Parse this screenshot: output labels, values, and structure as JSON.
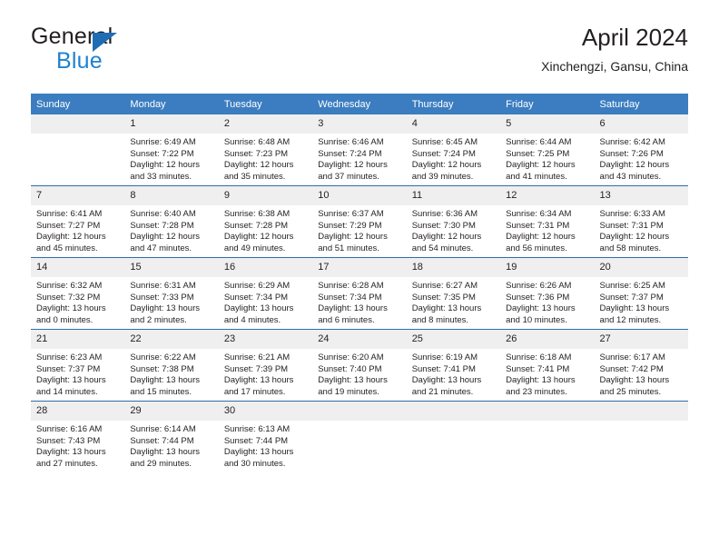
{
  "brand": {
    "name_top": "General",
    "name_bottom": "Blue",
    "accent_color": "#1f81d0",
    "triangle_color": "#1f6cb4"
  },
  "header": {
    "title": "April 2024",
    "subtitle": "Xinchengzi, Gansu, China"
  },
  "theme": {
    "header_bg": "#3b7dc0",
    "daynum_bg": "#efefef",
    "row_line": "#2e6da4",
    "text": "#231f20"
  },
  "weekdays": [
    "Sunday",
    "Monday",
    "Tuesday",
    "Wednesday",
    "Thursday",
    "Friday",
    "Saturday"
  ],
  "labels": {
    "sunrise_prefix": "Sunrise:",
    "sunset_prefix": "Sunset:",
    "daylight_prefix": "Daylight:"
  },
  "weeks": [
    [
      {
        "day": "",
        "empty": true
      },
      {
        "day": "1",
        "sunrise": "Sunrise: 6:49 AM",
        "sunset": "Sunset: 7:22 PM",
        "daylight_l1": "Daylight: 12 hours",
        "daylight_l2": "and 33 minutes."
      },
      {
        "day": "2",
        "sunrise": "Sunrise: 6:48 AM",
        "sunset": "Sunset: 7:23 PM",
        "daylight_l1": "Daylight: 12 hours",
        "daylight_l2": "and 35 minutes."
      },
      {
        "day": "3",
        "sunrise": "Sunrise: 6:46 AM",
        "sunset": "Sunset: 7:24 PM",
        "daylight_l1": "Daylight: 12 hours",
        "daylight_l2": "and 37 minutes."
      },
      {
        "day": "4",
        "sunrise": "Sunrise: 6:45 AM",
        "sunset": "Sunset: 7:24 PM",
        "daylight_l1": "Daylight: 12 hours",
        "daylight_l2": "and 39 minutes."
      },
      {
        "day": "5",
        "sunrise": "Sunrise: 6:44 AM",
        "sunset": "Sunset: 7:25 PM",
        "daylight_l1": "Daylight: 12 hours",
        "daylight_l2": "and 41 minutes."
      },
      {
        "day": "6",
        "sunrise": "Sunrise: 6:42 AM",
        "sunset": "Sunset: 7:26 PM",
        "daylight_l1": "Daylight: 12 hours",
        "daylight_l2": "and 43 minutes."
      }
    ],
    [
      {
        "day": "7",
        "sunrise": "Sunrise: 6:41 AM",
        "sunset": "Sunset: 7:27 PM",
        "daylight_l1": "Daylight: 12 hours",
        "daylight_l2": "and 45 minutes."
      },
      {
        "day": "8",
        "sunrise": "Sunrise: 6:40 AM",
        "sunset": "Sunset: 7:28 PM",
        "daylight_l1": "Daylight: 12 hours",
        "daylight_l2": "and 47 minutes."
      },
      {
        "day": "9",
        "sunrise": "Sunrise: 6:38 AM",
        "sunset": "Sunset: 7:28 PM",
        "daylight_l1": "Daylight: 12 hours",
        "daylight_l2": "and 49 minutes."
      },
      {
        "day": "10",
        "sunrise": "Sunrise: 6:37 AM",
        "sunset": "Sunset: 7:29 PM",
        "daylight_l1": "Daylight: 12 hours",
        "daylight_l2": "and 51 minutes."
      },
      {
        "day": "11",
        "sunrise": "Sunrise: 6:36 AM",
        "sunset": "Sunset: 7:30 PM",
        "daylight_l1": "Daylight: 12 hours",
        "daylight_l2": "and 54 minutes."
      },
      {
        "day": "12",
        "sunrise": "Sunrise: 6:34 AM",
        "sunset": "Sunset: 7:31 PM",
        "daylight_l1": "Daylight: 12 hours",
        "daylight_l2": "and 56 minutes."
      },
      {
        "day": "13",
        "sunrise": "Sunrise: 6:33 AM",
        "sunset": "Sunset: 7:31 PM",
        "daylight_l1": "Daylight: 12 hours",
        "daylight_l2": "and 58 minutes."
      }
    ],
    [
      {
        "day": "14",
        "sunrise": "Sunrise: 6:32 AM",
        "sunset": "Sunset: 7:32 PM",
        "daylight_l1": "Daylight: 13 hours",
        "daylight_l2": "and 0 minutes."
      },
      {
        "day": "15",
        "sunrise": "Sunrise: 6:31 AM",
        "sunset": "Sunset: 7:33 PM",
        "daylight_l1": "Daylight: 13 hours",
        "daylight_l2": "and 2 minutes."
      },
      {
        "day": "16",
        "sunrise": "Sunrise: 6:29 AM",
        "sunset": "Sunset: 7:34 PM",
        "daylight_l1": "Daylight: 13 hours",
        "daylight_l2": "and 4 minutes."
      },
      {
        "day": "17",
        "sunrise": "Sunrise: 6:28 AM",
        "sunset": "Sunset: 7:34 PM",
        "daylight_l1": "Daylight: 13 hours",
        "daylight_l2": "and 6 minutes."
      },
      {
        "day": "18",
        "sunrise": "Sunrise: 6:27 AM",
        "sunset": "Sunset: 7:35 PM",
        "daylight_l1": "Daylight: 13 hours",
        "daylight_l2": "and 8 minutes."
      },
      {
        "day": "19",
        "sunrise": "Sunrise: 6:26 AM",
        "sunset": "Sunset: 7:36 PM",
        "daylight_l1": "Daylight: 13 hours",
        "daylight_l2": "and 10 minutes."
      },
      {
        "day": "20",
        "sunrise": "Sunrise: 6:25 AM",
        "sunset": "Sunset: 7:37 PM",
        "daylight_l1": "Daylight: 13 hours",
        "daylight_l2": "and 12 minutes."
      }
    ],
    [
      {
        "day": "21",
        "sunrise": "Sunrise: 6:23 AM",
        "sunset": "Sunset: 7:37 PM",
        "daylight_l1": "Daylight: 13 hours",
        "daylight_l2": "and 14 minutes."
      },
      {
        "day": "22",
        "sunrise": "Sunrise: 6:22 AM",
        "sunset": "Sunset: 7:38 PM",
        "daylight_l1": "Daylight: 13 hours",
        "daylight_l2": "and 15 minutes."
      },
      {
        "day": "23",
        "sunrise": "Sunrise: 6:21 AM",
        "sunset": "Sunset: 7:39 PM",
        "daylight_l1": "Daylight: 13 hours",
        "daylight_l2": "and 17 minutes."
      },
      {
        "day": "24",
        "sunrise": "Sunrise: 6:20 AM",
        "sunset": "Sunset: 7:40 PM",
        "daylight_l1": "Daylight: 13 hours",
        "daylight_l2": "and 19 minutes."
      },
      {
        "day": "25",
        "sunrise": "Sunrise: 6:19 AM",
        "sunset": "Sunset: 7:41 PM",
        "daylight_l1": "Daylight: 13 hours",
        "daylight_l2": "and 21 minutes."
      },
      {
        "day": "26",
        "sunrise": "Sunrise: 6:18 AM",
        "sunset": "Sunset: 7:41 PM",
        "daylight_l1": "Daylight: 13 hours",
        "daylight_l2": "and 23 minutes."
      },
      {
        "day": "27",
        "sunrise": "Sunrise: 6:17 AM",
        "sunset": "Sunset: 7:42 PM",
        "daylight_l1": "Daylight: 13 hours",
        "daylight_l2": "and 25 minutes."
      }
    ],
    [
      {
        "day": "28",
        "sunrise": "Sunrise: 6:16 AM",
        "sunset": "Sunset: 7:43 PM",
        "daylight_l1": "Daylight: 13 hours",
        "daylight_l2": "and 27 minutes."
      },
      {
        "day": "29",
        "sunrise": "Sunrise: 6:14 AM",
        "sunset": "Sunset: 7:44 PM",
        "daylight_l1": "Daylight: 13 hours",
        "daylight_l2": "and 29 minutes."
      },
      {
        "day": "30",
        "sunrise": "Sunrise: 6:13 AM",
        "sunset": "Sunset: 7:44 PM",
        "daylight_l1": "Daylight: 13 hours",
        "daylight_l2": "and 30 minutes."
      },
      {
        "day": "",
        "empty": true
      },
      {
        "day": "",
        "empty": true
      },
      {
        "day": "",
        "empty": true
      },
      {
        "day": "",
        "empty": true
      }
    ]
  ]
}
